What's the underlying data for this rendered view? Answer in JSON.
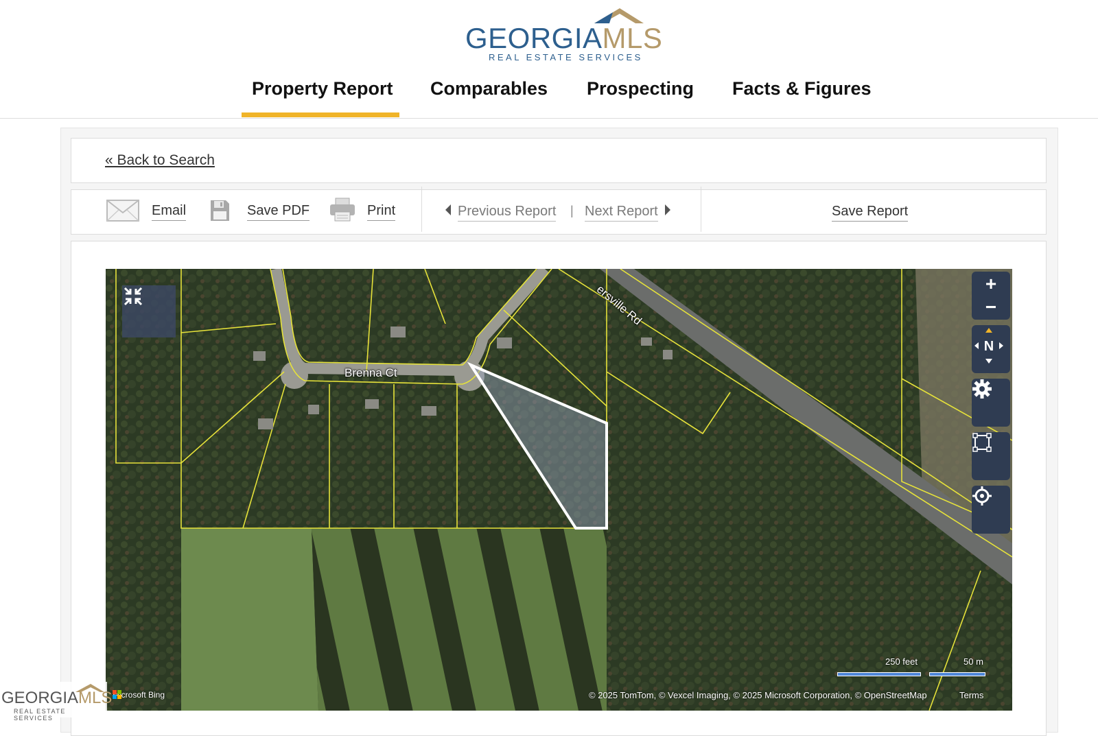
{
  "header": {
    "logo_word_primary": "GEORGIA",
    "logo_word_secondary": "MLS",
    "logo_tagline": "REAL ESTATE SERVICES",
    "brand_color": "#2d5f8e",
    "accent_color": "#b59a6a",
    "active_tab_color": "#f0b429"
  },
  "nav": {
    "tabs": [
      {
        "label": "Property Report",
        "active": true
      },
      {
        "label": "Comparables",
        "active": false
      },
      {
        "label": "Prospecting",
        "active": false
      },
      {
        "label": "Facts & Figures",
        "active": false
      }
    ]
  },
  "back_link": "« Back to Search",
  "toolbar": {
    "email": "Email",
    "save_pdf": "Save PDF",
    "print": "Print",
    "previous_report": "Previous Report",
    "divider": "|",
    "next_report": "Next Report",
    "save_report": "Save Report"
  },
  "map": {
    "road_labels": [
      "Brenna Ct",
      "ersville Rd"
    ],
    "controls": {
      "zoom_in": "+",
      "zoom_out": "−",
      "compass": "N"
    },
    "scale": {
      "imperial": "250 feet",
      "metric": "50 m"
    },
    "attribution": "© 2025 TomTom, © Vexcel Imaging, © 2025 Microsoft Corporation, © OpenStreetMap",
    "terms": "Terms",
    "provider": "Microsoft Bing",
    "watermark_word_primary": "GEORGIA",
    "watermark_word_secondary": "MLS",
    "watermark_tagline": "REAL ESTATE SERVICES"
  }
}
